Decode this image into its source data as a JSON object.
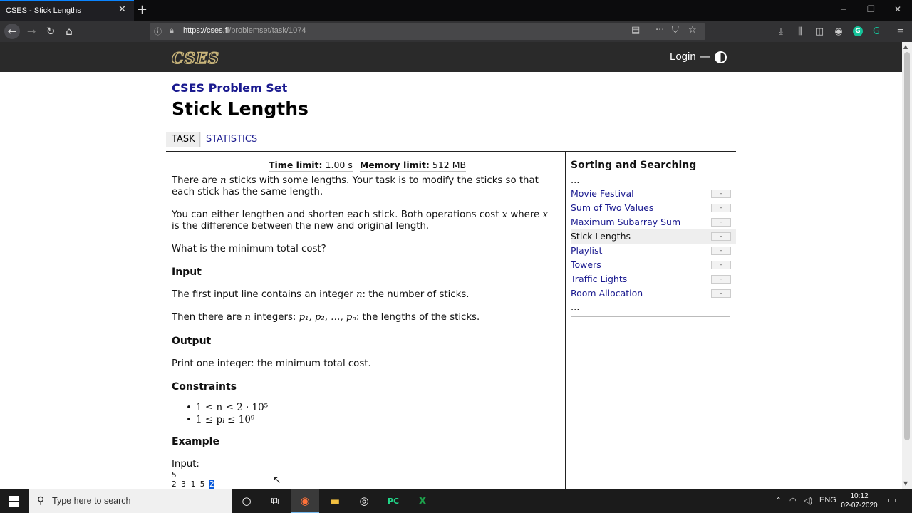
{
  "browser": {
    "tab_title": "CSES - Stick Lengths",
    "tab_close": "✕",
    "new_tab": "+",
    "url_host": "https://cses.fi",
    "url_path": "/problemset/task/1074"
  },
  "site": {
    "login": "Login",
    "dash": "—"
  },
  "page": {
    "breadcrumb": "CSES Problem Set",
    "title": "Stick Lengths",
    "tabs": [
      {
        "label": "TASK"
      },
      {
        "label": "STATISTICS"
      }
    ],
    "time_label": "Time limit:",
    "time_value": "1.00 s",
    "memory_label": "Memory limit:",
    "memory_value": "512 MB",
    "p1a": "There are ",
    "p1_var": "n",
    "p1b": " sticks with some lengths. Your task is to modify the sticks so that each stick has the same length.",
    "p2a": "You can either lengthen and shorten each stick. Both operations cost ",
    "p2_var1": "x",
    "p2b": " where ",
    "p2_var2": "x",
    "p2c": " is the difference between the new and original length.",
    "p3": "What is the minimum total cost?",
    "h_input": "Input",
    "p4a": "The first input line contains an integer ",
    "p4_var": "n",
    "p4b": ": the number of sticks.",
    "p5a": "Then there are ",
    "p5_var": "n",
    "p5b": " integers: ",
    "p5_seq": "p₁, p₂, …, pₙ",
    "p5c": ": the lengths of the sticks.",
    "h_output": "Output",
    "p6": "Print one integer: the minimum total cost.",
    "h_constraints": "Constraints",
    "constraints": [
      "1 ≤ n ≤ 2 · 10⁵",
      "1 ≤ pᵢ ≤ 10⁹"
    ],
    "h_example": "Example",
    "input_label": "Input:",
    "ex_line1": "5",
    "ex_line2": "2 3 1 5 ",
    "ex_selected": "2"
  },
  "sidebar": {
    "title": "Sorting and Searching",
    "dots_top": "...",
    "dots_bottom": "...",
    "items": [
      {
        "label": "Movie Festival",
        "tag": "–"
      },
      {
        "label": "Sum of Two Values",
        "tag": "–"
      },
      {
        "label": "Maximum Subarray Sum",
        "tag": "–"
      },
      {
        "label": "Stick Lengths",
        "tag": "–"
      },
      {
        "label": "Playlist",
        "tag": "–"
      },
      {
        "label": "Towers",
        "tag": "–"
      },
      {
        "label": "Traffic Lights",
        "tag": "–"
      },
      {
        "label": "Room Allocation",
        "tag": "–"
      }
    ]
  },
  "taskbar": {
    "search_placeholder": "Type here to search",
    "lang": "ENG",
    "time": "10:12",
    "date": "02-07-2020"
  },
  "colors": {
    "accent_link": "#1a1a8f",
    "header_bg": "#2a2a2a",
    "logo_gold": "#c9b57a"
  }
}
